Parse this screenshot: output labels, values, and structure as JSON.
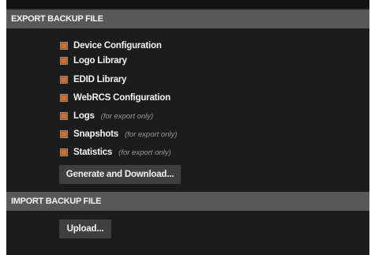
{
  "export": {
    "title": "EXPORT BACKUP FILE",
    "items": [
      {
        "label": "Device Configuration",
        "note": ""
      },
      {
        "label": "Logo Library",
        "note": ""
      },
      {
        "label": "EDID Library",
        "note": ""
      },
      {
        "label": "WebRCS Configuration",
        "note": ""
      },
      {
        "label": "Logs",
        "note": "(for export only)"
      },
      {
        "label": "Snapshots",
        "note": "(for export only)"
      },
      {
        "label": "Statistics",
        "note": "(for export only)"
      }
    ],
    "generate_label": "Generate and Download..."
  },
  "import": {
    "title": "IMPORT BACKUP FILE",
    "upload_label": "Upload..."
  },
  "colors": {
    "panel_bg": "#1c1c1c",
    "header_bg": "#585858",
    "checkbox_fill": "#d0702c",
    "button_bg": "#3f3f3f"
  }
}
